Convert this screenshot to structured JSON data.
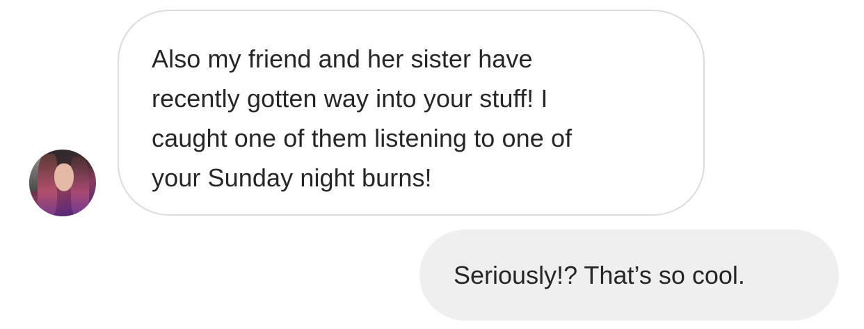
{
  "conversation": {
    "incoming": {
      "avatar_icon": "user-avatar-photo",
      "message": "Also my friend and her sister have\nrecently gotten way into your stuff! I\ncaught one of them listening to one of\nyour Sunday night burns!"
    },
    "outgoing": {
      "message": "Seriously!? That’s so cool."
    }
  },
  "colors": {
    "incoming_border": "#dbdbdb",
    "outgoing_background": "#efefef",
    "text": "#262626"
  }
}
